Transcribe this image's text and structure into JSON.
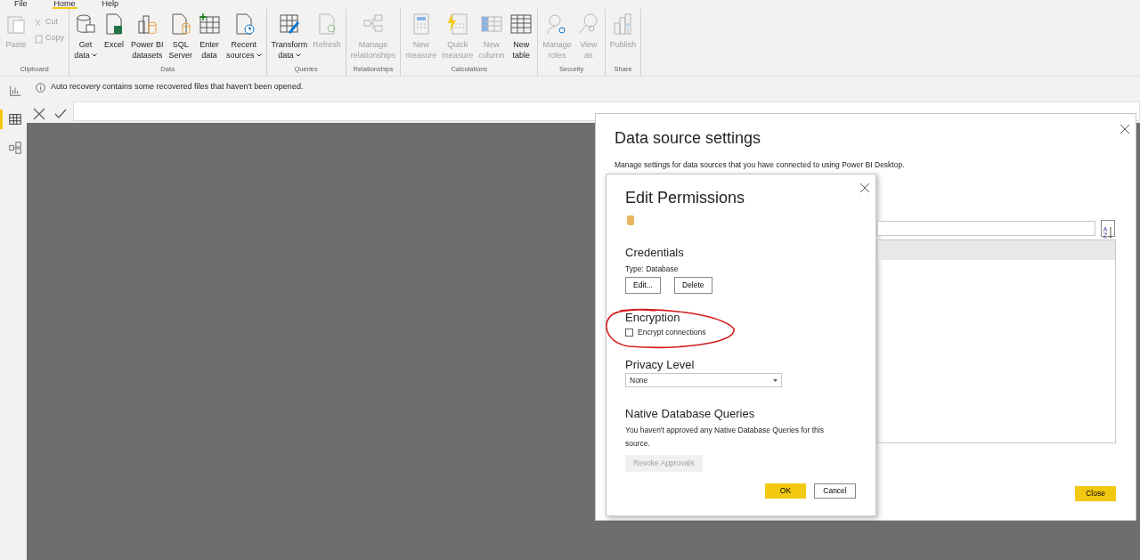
{
  "menu_tabs": [
    {
      "label": "File",
      "selected": false
    },
    {
      "label": "Home",
      "selected": true
    },
    {
      "label": "Help",
      "selected": false
    }
  ],
  "ribbon_groups": [
    {
      "label": "Clipboard",
      "buttons": [
        {
          "kind": "large",
          "lines": [
            "Paste"
          ],
          "dropdown": false,
          "disabled": true
        },
        {
          "kind": "small",
          "lines": [
            "Cut"
          ],
          "dropdown": false,
          "disabled": true
        },
        {
          "kind": "small",
          "lines": [
            "Copy"
          ],
          "dropdown": false,
          "disabled": true
        }
      ]
    },
    {
      "label": "Data",
      "buttons": [
        {
          "kind": "large",
          "lines": [
            "Get",
            "data"
          ],
          "dropdown": true,
          "disabled": false
        },
        {
          "kind": "large",
          "lines": [
            "Excel"
          ],
          "dropdown": false,
          "disabled": false
        },
        {
          "kind": "large",
          "lines": [
            "Power BI",
            "datasets"
          ],
          "dropdown": false,
          "disabled": false
        },
        {
          "kind": "large",
          "lines": [
            "SQL",
            "Server"
          ],
          "dropdown": false,
          "disabled": false
        },
        {
          "kind": "large",
          "lines": [
            "Enter",
            "data"
          ],
          "dropdown": false,
          "disabled": false
        },
        {
          "kind": "large",
          "lines": [
            "Recent",
            "sources"
          ],
          "dropdown": true,
          "disabled": false
        }
      ]
    },
    {
      "label": "Queries",
      "buttons": [
        {
          "kind": "large",
          "lines": [
            "Transform",
            "data"
          ],
          "dropdown": true,
          "disabled": false
        },
        {
          "kind": "large",
          "lines": [
            "Refresh"
          ],
          "dropdown": false,
          "disabled": true
        }
      ]
    },
    {
      "label": "Relationships",
      "buttons": [
        {
          "kind": "large",
          "lines": [
            "Manage",
            "relationships"
          ],
          "dropdown": false,
          "disabled": true
        }
      ]
    },
    {
      "label": "Calculations",
      "buttons": [
        {
          "kind": "large",
          "lines": [
            "New",
            "measure"
          ],
          "dropdown": false,
          "disabled": true
        },
        {
          "kind": "large",
          "lines": [
            "Quick",
            "measure"
          ],
          "dropdown": false,
          "disabled": true
        },
        {
          "kind": "large",
          "lines": [
            "New",
            "column"
          ],
          "dropdown": false,
          "disabled": true
        },
        {
          "kind": "large",
          "lines": [
            "New",
            "table"
          ],
          "dropdown": false,
          "disabled": false
        }
      ]
    },
    {
      "label": "Security",
      "buttons": [
        {
          "kind": "large",
          "lines": [
            "Manage",
            "roles"
          ],
          "dropdown": false,
          "disabled": true
        },
        {
          "kind": "large",
          "lines": [
            "View",
            "as"
          ],
          "dropdown": false,
          "disabled": true
        }
      ]
    },
    {
      "label": "Share",
      "buttons": [
        {
          "kind": "large",
          "lines": [
            "Publish"
          ],
          "dropdown": false,
          "disabled": true
        }
      ]
    }
  ],
  "notification": {
    "text": "Auto recovery contains some recovered files that haven't been opened."
  },
  "sidebar": {
    "items": [
      {
        "selected": false
      },
      {
        "selected": true
      },
      {
        "selected": false
      }
    ]
  },
  "data_source_settings": {
    "title": "Data source settings",
    "description": "Manage settings for data sources that you have connected to using Power BI Desktop.",
    "close_button": "Close"
  },
  "edit_permissions": {
    "title": "Edit Permissions",
    "credentials": {
      "heading": "Credentials",
      "type": "Type: Database",
      "buttons": [
        "Edit...",
        "Delete"
      ]
    },
    "encryption": {
      "heading": "Encryption",
      "label": "Encrypt connections",
      "checked": false
    },
    "privacy": {
      "heading": "Privacy Level",
      "value": "None"
    },
    "native_queries": {
      "heading": "Native Database Queries",
      "text": "You haven't approved any Native Database Queries for this source.",
      "button": "Revoke Approvals",
      "button_disabled": true
    },
    "ok": "OK",
    "cancel": "Cancel"
  }
}
